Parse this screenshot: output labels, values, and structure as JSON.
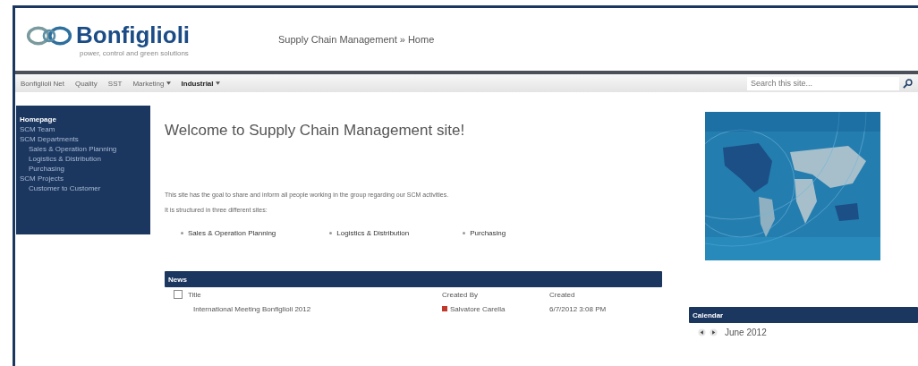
{
  "header": {
    "logo": "Bonfiglioli",
    "tagline": "power, control and green solutions",
    "breadcrumb": "Supply Chain Management » Home"
  },
  "top_nav": [
    {
      "label": "Bonfiglioli Net",
      "selected": false,
      "dropdown": false
    },
    {
      "label": "Quality",
      "selected": false,
      "dropdown": false
    },
    {
      "label": "SST",
      "selected": false,
      "dropdown": false
    },
    {
      "label": "Marketing",
      "selected": false,
      "dropdown": true
    },
    {
      "label": "Industrial",
      "selected": true,
      "dropdown": true
    }
  ],
  "search": {
    "placeholder": "Search this site..."
  },
  "sidebar": {
    "items": [
      {
        "label": "Homepage",
        "selected": true
      },
      {
        "label": "SCM Team",
        "selected": false
      },
      {
        "label": "SCM Departments",
        "selected": false,
        "children": [
          {
            "label": "Sales & Operation Planning",
            "selected": false
          },
          {
            "label": "Logistics & Distribution",
            "selected": false
          },
          {
            "label": "Purchasing",
            "selected": false
          }
        ]
      },
      {
        "label": "SCM Projects",
        "selected": false,
        "children": [
          {
            "label": "Customer to Customer",
            "selected": false
          }
        ]
      }
    ]
  },
  "main": {
    "title": "Welcome to Supply Chain Management site!",
    "paragraphs": [
      "This site has the goal to share and inform all people working in the group regarding our SCM activities.",
      "It is structured in three different sites:"
    ],
    "links": [
      "Sales & Operation Planning",
      "Logistics & Distribution",
      "Purchasing"
    ]
  },
  "news": {
    "title": "News",
    "select_all": {
      "checked": false
    },
    "columns": [
      "Title",
      "Created By",
      "Created"
    ],
    "rows": [
      {
        "title": "International Meeting Bonfiglioli 2012",
        "created_by": "Salvatore Carella",
        "created": "6/7/2012 3:08 PM",
        "color": "#c0392b"
      }
    ]
  },
  "calendar": {
    "title": "Calendar",
    "month": "June 2012"
  }
}
